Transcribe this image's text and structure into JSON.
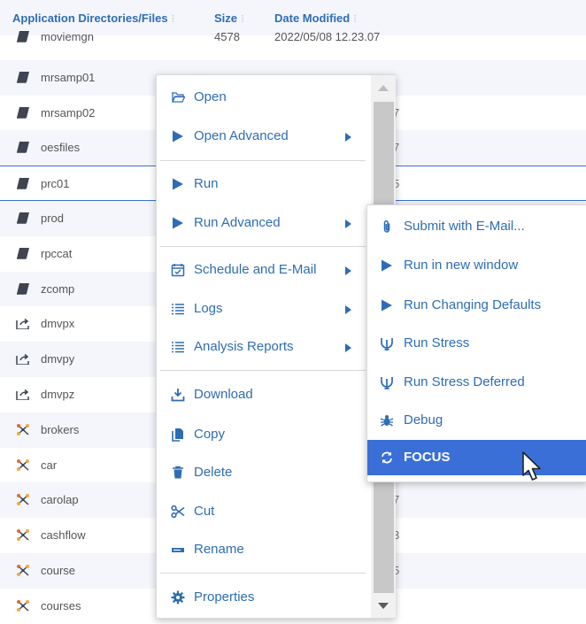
{
  "table": {
    "headers": {
      "name": "Application Directories/Files",
      "size": "Size",
      "date": "Date Modified"
    },
    "rows": [
      {
        "name": "moviemgn",
        "type": "file",
        "size": "4578",
        "date": "2022/05/08 12.23.07"
      },
      {
        "name": "mrsamp01",
        "type": "file",
        "size": "",
        "date": "",
        "peek": ""
      },
      {
        "name": "mrsamp02",
        "type": "file",
        "size": "",
        "date": "",
        "peek": "7"
      },
      {
        "name": "oesfiles",
        "type": "file",
        "size": "",
        "date": "",
        "peek": "7"
      },
      {
        "name": "prc01",
        "type": "file",
        "size": "",
        "date": "",
        "peek": "5"
      },
      {
        "name": "prod",
        "type": "file",
        "size": "",
        "date": "",
        "peek": ""
      },
      {
        "name": "rpccat",
        "type": "file",
        "size": "",
        "date": "",
        "peek": ""
      },
      {
        "name": "zcomp",
        "type": "file",
        "size": "",
        "date": "",
        "peek": ""
      },
      {
        "name": "dmvpx",
        "type": "link",
        "size": "",
        "date": "",
        "peek": ""
      },
      {
        "name": "dmvpy",
        "type": "link",
        "size": "",
        "date": "",
        "peek": ""
      },
      {
        "name": "dmvpz",
        "type": "link",
        "size": "",
        "date": "",
        "peek": ""
      },
      {
        "name": "brokers",
        "type": "cube",
        "size": "",
        "date": "",
        "peek": ""
      },
      {
        "name": "car",
        "type": "cube",
        "size": "",
        "date": "",
        "peek": ""
      },
      {
        "name": "carolap",
        "type": "cube",
        "size": "",
        "date": "",
        "peek": "7"
      },
      {
        "name": "cashflow",
        "type": "cube",
        "size": "",
        "date": "",
        "peek": "3"
      },
      {
        "name": "course",
        "type": "cube",
        "size": "",
        "date": "",
        "peek": "5"
      },
      {
        "name": "courses",
        "type": "cube",
        "size": "",
        "date": "",
        "peek": ""
      }
    ]
  },
  "menu": {
    "items": [
      {
        "label": "Open",
        "icon": "folder-open-icon",
        "submenu": false
      },
      {
        "label": "Open Advanced",
        "icon": "play-icon",
        "submenu": true
      },
      {
        "label": "Run",
        "icon": "play-icon",
        "submenu": false
      },
      {
        "label": "Run Advanced",
        "icon": "play-icon",
        "submenu": true
      },
      {
        "label": "Schedule and E-Mail",
        "icon": "calendar-check-icon",
        "submenu": true
      },
      {
        "label": "Logs",
        "icon": "list-icon",
        "submenu": true
      },
      {
        "label": "Analysis Reports",
        "icon": "list-icon",
        "submenu": true
      },
      {
        "label": "Download",
        "icon": "download-icon",
        "submenu": false
      },
      {
        "label": "Copy",
        "icon": "copy-icon",
        "submenu": false
      },
      {
        "label": "Delete",
        "icon": "trash-icon",
        "submenu": false
      },
      {
        "label": "Cut",
        "icon": "scissors-icon",
        "submenu": false
      },
      {
        "label": "Rename",
        "icon": "rename-icon",
        "submenu": false
      },
      {
        "label": "Properties",
        "icon": "gear-icon",
        "submenu": false
      }
    ]
  },
  "submenu": {
    "items": [
      {
        "label": "Submit with E-Mail...",
        "icon": "paperclip-icon"
      },
      {
        "label": "Run in new window",
        "icon": "play-icon"
      },
      {
        "label": "Run Changing Defaults",
        "icon": "play-icon"
      },
      {
        "label": "Run Stress",
        "icon": "stress-icon"
      },
      {
        "label": "Run Stress Deferred",
        "icon": "stress-icon"
      },
      {
        "label": "Debug",
        "icon": "bug-icon"
      },
      {
        "label": "FOCUS",
        "icon": "refresh-icon",
        "active": true
      }
    ]
  },
  "colors": {
    "accent": "#2e6db4",
    "highlight": "#3a6fd8",
    "stripe": "#f4f6fb"
  }
}
